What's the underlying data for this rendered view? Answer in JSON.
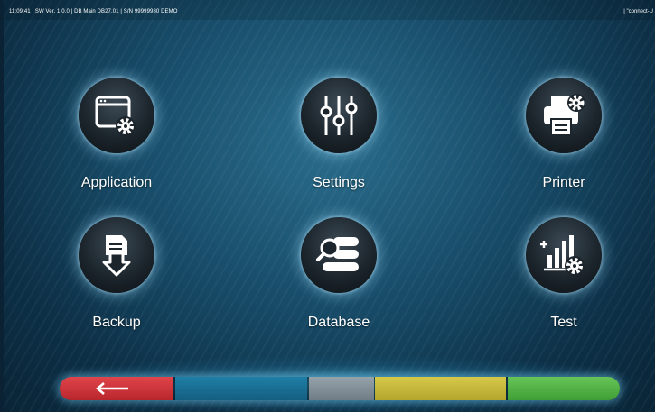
{
  "status_bar": {
    "left": "11:09:41  |  SW Ver. 1.0.0  |  DB Main DB27.01  |  S/N 99999980 DEMO",
    "right": "|  \"connect-U"
  },
  "tiles": [
    {
      "label": "Application",
      "icon": "application-settings-icon"
    },
    {
      "label": "Settings",
      "icon": "sliders-icon"
    },
    {
      "label": "Printer",
      "icon": "printer-settings-icon"
    },
    {
      "label": "Backup",
      "icon": "backup-download-icon"
    },
    {
      "label": "Database",
      "icon": "database-search-icon"
    },
    {
      "label": "Test",
      "icon": "chart-settings-icon"
    }
  ],
  "bottom_bar": {
    "buttons": [
      {
        "name": "back",
        "icon": "left-arrow-icon",
        "color": "#c9313a"
      },
      {
        "name": "blue",
        "color": "#1a6f95"
      },
      {
        "name": "gray",
        "color": "#85919a"
      },
      {
        "name": "yellow",
        "color": "#c9bb3a"
      },
      {
        "name": "green",
        "color": "#52b346"
      }
    ]
  }
}
